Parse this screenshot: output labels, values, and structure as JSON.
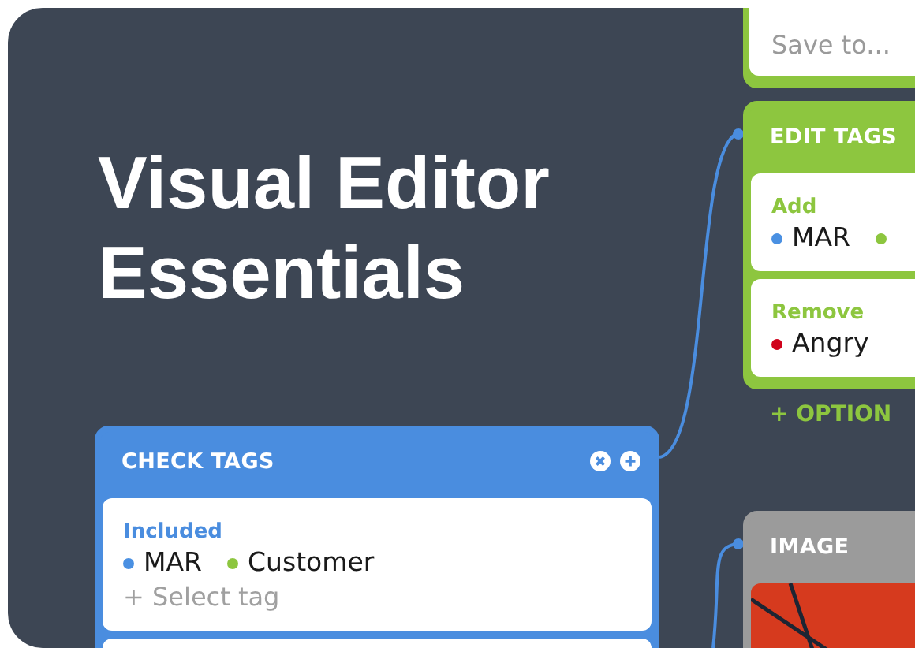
{
  "title": "Visual Editor Essentials",
  "nodes": [
    {
      "kind": "save",
      "color": "#8dc63f",
      "placeholder": "Save to..."
    },
    {
      "kind": "tags",
      "title": "EDIT TAGS",
      "color": "#8dc63f",
      "header_buttons": false,
      "sections": [
        {
          "label": "Add",
          "tags": [
            {
              "name": "MAR",
              "color": "#4a90e2"
            },
            {
              "color": "#8dc63f"
            }
          ]
        },
        {
          "label": "Remove",
          "tags": [
            {
              "name": "Angry",
              "color": "#d0021b"
            }
          ]
        }
      ],
      "add_option": "+ OPTION"
    },
    {
      "kind": "image",
      "title": "IMAGE",
      "color": "#9b9b9b"
    },
    {
      "kind": "tags",
      "title": "CHECK TAGS",
      "color": "#4a8ddf",
      "header_buttons": true,
      "continues": true,
      "sections": [
        {
          "label": "Included",
          "tags": [
            {
              "name": "MAR",
              "color": "#4a90e2"
            },
            {
              "name": "Customer",
              "color": "#8dc63f"
            }
          ],
          "select_placeholder": "+ Select tag"
        }
      ]
    }
  ]
}
